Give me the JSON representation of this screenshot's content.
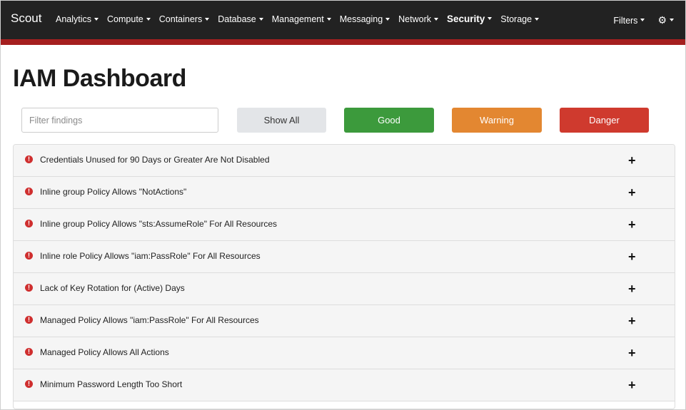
{
  "nav": {
    "brand": "Scout",
    "items": [
      {
        "label": "Analytics",
        "active": false
      },
      {
        "label": "Compute",
        "active": false
      },
      {
        "label": "Containers",
        "active": false
      },
      {
        "label": "Database",
        "active": false
      },
      {
        "label": "Management",
        "active": false
      },
      {
        "label": "Messaging",
        "active": false
      },
      {
        "label": "Network",
        "active": false
      },
      {
        "label": "Security",
        "active": true
      },
      {
        "label": "Storage",
        "active": false
      }
    ],
    "filters_label": "Filters",
    "settings_icon": "gear-icon"
  },
  "page": {
    "title": "IAM Dashboard"
  },
  "filter_bar": {
    "placeholder": "Filter findings",
    "show_all_label": "Show All",
    "good_label": "Good",
    "warning_label": "Warning",
    "danger_label": "Danger"
  },
  "colors": {
    "navbar_bg": "#222222",
    "navbar_accent": "#a51f1f",
    "good": "#3c9a3c",
    "warning": "#e38731",
    "danger": "#cf3a2e",
    "show_all": "#e3e5e8"
  },
  "findings": [
    {
      "label": "Credentials Unused for 90 Days or Greater Are Not Disabled",
      "level": "danger"
    },
    {
      "label": "Inline group Policy Allows \"NotActions\"",
      "level": "danger"
    },
    {
      "label": "Inline group Policy Allows \"sts:AssumeRole\" For All Resources",
      "level": "danger"
    },
    {
      "label": "Inline role Policy Allows \"iam:PassRole\" For All Resources",
      "level": "danger"
    },
    {
      "label": "Lack of Key Rotation for (Active) Days",
      "level": "danger"
    },
    {
      "label": "Managed Policy Allows \"iam:PassRole\" For All Resources",
      "level": "danger"
    },
    {
      "label": "Managed Policy Allows All Actions",
      "level": "danger"
    },
    {
      "label": "Minimum Password Length Too Short",
      "level": "danger"
    }
  ]
}
